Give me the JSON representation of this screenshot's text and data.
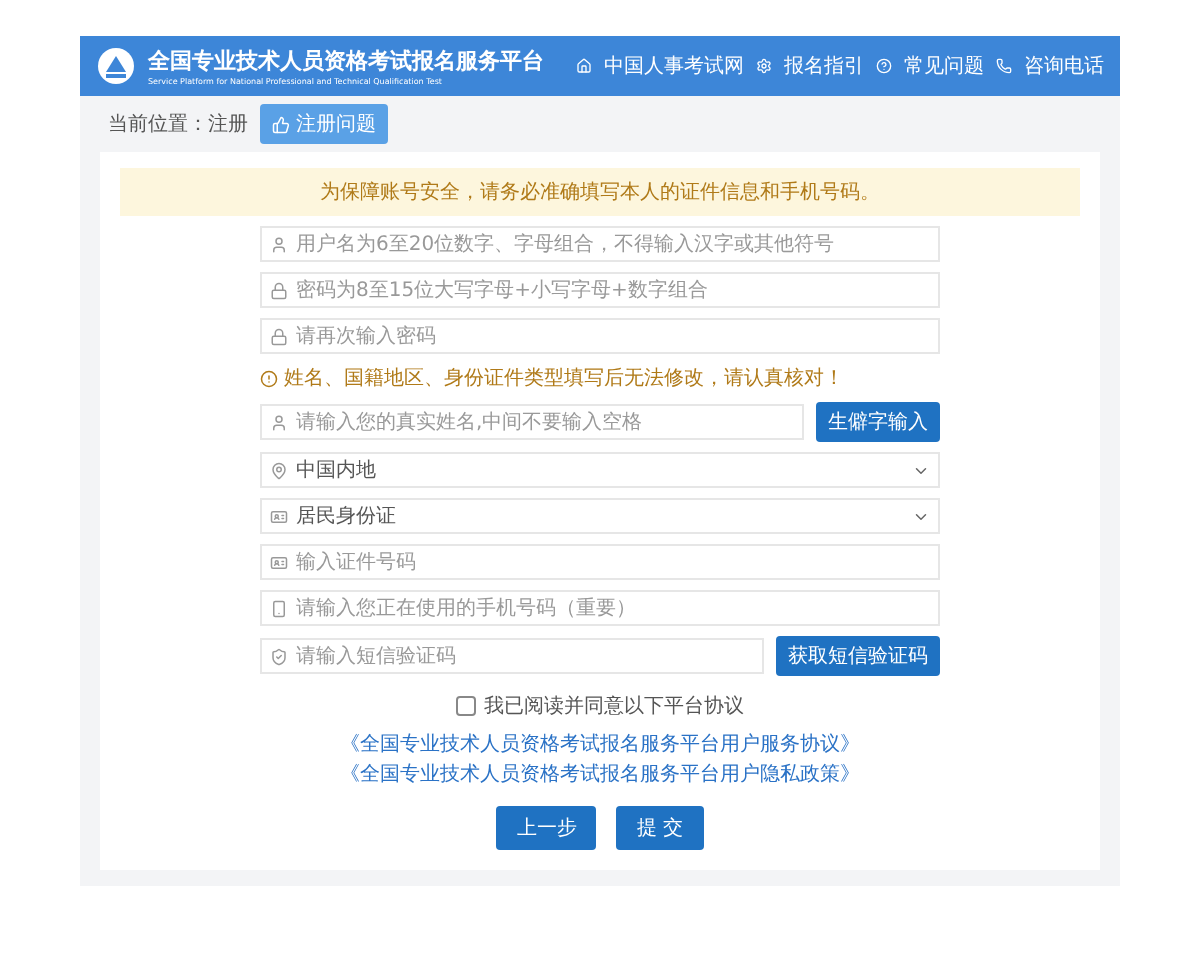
{
  "header": {
    "title": "全国专业技术人员资格考试报名服务平台",
    "subtitle": "Service Platform for National Professional and Technical Qualification Test",
    "nav": [
      "中国人事考试网",
      "报名指引",
      "常见问题",
      "咨询电话"
    ]
  },
  "breadcrumb": {
    "label": "当前位置：注册",
    "button": "注册问题"
  },
  "notice": "为保障账号安全，请务必准确填写本人的证件信息和手机号码。",
  "rows": [
    {
      "kind": "input",
      "placeholder": "用户名为6至20位数字、字母组合，不得输入汉字或其他符号"
    },
    {
      "kind": "input",
      "placeholder": "密码为8至15位大写字母+小写字母+数字组合"
    },
    {
      "kind": "input",
      "placeholder": "请再次输入密码"
    },
    {
      "kind": "warning",
      "text": "姓名、国籍地区、身份证件类型填写后无法修改，请认真核对！"
    },
    {
      "kind": "input_button",
      "placeholder": "请输入您的真实姓名,中间不要输入空格",
      "button": "生僻字输入"
    },
    {
      "kind": "select",
      "value": "中国内地"
    },
    {
      "kind": "select",
      "value": "居民身份证"
    },
    {
      "kind": "input",
      "placeholder": "输入证件号码"
    },
    {
      "kind": "input",
      "placeholder": "请输入您正在使用的手机号码（重要）"
    },
    {
      "kind": "input_button",
      "placeholder": "请输入短信验证码",
      "button": "获取短信验证码"
    }
  ],
  "agreement": {
    "label": "我已阅读并同意以下平台协议",
    "checked": false,
    "links": [
      "《全国专业技术人员资格考试报名服务平台用户服务协议》",
      "《全国专业技术人员资格考试报名服务平台用户隐私政策》"
    ]
  },
  "buttons": [
    "上一步",
    "提 交"
  ]
}
